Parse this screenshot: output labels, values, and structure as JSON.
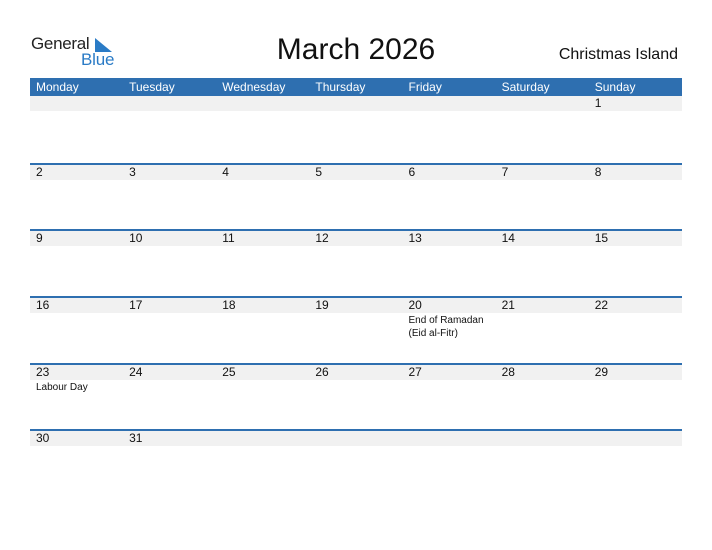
{
  "logo": {
    "part1": "General",
    "part2": "Blue",
    "icon": "triangle-flag-icon"
  },
  "title": "March 2026",
  "country": "Christmas Island",
  "colors": {
    "header_bg": "#2e6fb0",
    "band_bg": "#f1f1f1",
    "logo_blue": "#2a7bc6"
  },
  "weekdays": [
    "Monday",
    "Tuesday",
    "Wednesday",
    "Thursday",
    "Friday",
    "Saturday",
    "Sunday"
  ],
  "weeks": [
    {
      "days": [
        {
          "n": "",
          "e": ""
        },
        {
          "n": "",
          "e": ""
        },
        {
          "n": "",
          "e": ""
        },
        {
          "n": "",
          "e": ""
        },
        {
          "n": "",
          "e": ""
        },
        {
          "n": "",
          "e": ""
        },
        {
          "n": "1",
          "e": ""
        }
      ]
    },
    {
      "days": [
        {
          "n": "2",
          "e": ""
        },
        {
          "n": "3",
          "e": ""
        },
        {
          "n": "4",
          "e": ""
        },
        {
          "n": "5",
          "e": ""
        },
        {
          "n": "6",
          "e": ""
        },
        {
          "n": "7",
          "e": ""
        },
        {
          "n": "8",
          "e": ""
        }
      ]
    },
    {
      "days": [
        {
          "n": "9",
          "e": ""
        },
        {
          "n": "10",
          "e": ""
        },
        {
          "n": "11",
          "e": ""
        },
        {
          "n": "12",
          "e": ""
        },
        {
          "n": "13",
          "e": ""
        },
        {
          "n": "14",
          "e": ""
        },
        {
          "n": "15",
          "e": ""
        }
      ]
    },
    {
      "days": [
        {
          "n": "16",
          "e": ""
        },
        {
          "n": "17",
          "e": ""
        },
        {
          "n": "18",
          "e": ""
        },
        {
          "n": "19",
          "e": ""
        },
        {
          "n": "20",
          "e": "End of Ramadan (Eid al-Fitr)"
        },
        {
          "n": "21",
          "e": ""
        },
        {
          "n": "22",
          "e": ""
        }
      ]
    },
    {
      "days": [
        {
          "n": "23",
          "e": "Labour Day"
        },
        {
          "n": "24",
          "e": ""
        },
        {
          "n": "25",
          "e": ""
        },
        {
          "n": "26",
          "e": ""
        },
        {
          "n": "27",
          "e": ""
        },
        {
          "n": "28",
          "e": ""
        },
        {
          "n": "29",
          "e": ""
        }
      ]
    },
    {
      "days": [
        {
          "n": "30",
          "e": ""
        },
        {
          "n": "31",
          "e": ""
        },
        {
          "n": "",
          "e": ""
        },
        {
          "n": "",
          "e": ""
        },
        {
          "n": "",
          "e": ""
        },
        {
          "n": "",
          "e": ""
        },
        {
          "n": "",
          "e": ""
        }
      ]
    }
  ]
}
